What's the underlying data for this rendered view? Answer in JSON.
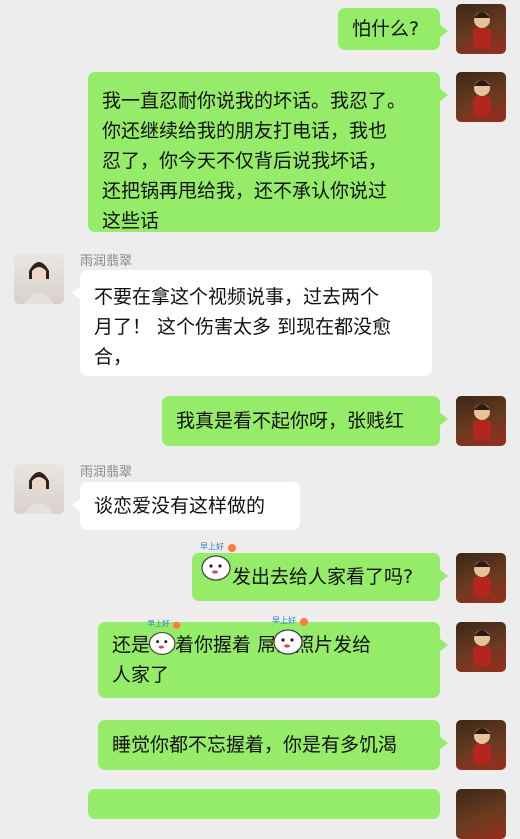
{
  "messages": [
    {
      "from": "me",
      "lines": [
        "怕什么?"
      ]
    },
    {
      "from": "me",
      "lines": [
        "我一直忍耐你说我的坏话。我忍了。",
        "你还继续给我的朋友打电话，我也",
        "忍了，你今天不仅背后说我坏话，",
        "还把锅再甩给我，还不承认你说过",
        "这些话"
      ]
    },
    {
      "from": "her",
      "sender": "雨润翡翠",
      "lines": [
        "不要在拿这个视频说事，过去两个",
        "月了！ 这个伤害太多 到现在都没愈",
        "合，"
      ]
    },
    {
      "from": "me",
      "lines": [
        "我真是看不起你呀，张贱红"
      ]
    },
    {
      "from": "her",
      "sender": "雨润翡翠",
      "lines": [
        "谈恋爱没有这样做的"
      ]
    },
    {
      "from": "me",
      "lines": [
        "发出去给人家看了吗?"
      ]
    },
    {
      "from": "me",
      "lines": [
        "还是 拿着你握着 屌的照片发给",
        "人家了"
      ]
    },
    {
      "from": "me",
      "lines": [
        "睡觉你都不忘握着，你是有多饥渴"
      ]
    }
  ],
  "stickers": [
    {
      "icon": "morning-sticker-icon",
      "caption": "早上好"
    },
    {
      "icon": "morning-sticker-icon",
      "caption": "早上好"
    },
    {
      "icon": "morning-sticker-icon",
      "caption": "早上好"
    }
  ],
  "colors": {
    "my_bubble": "#95ec69",
    "their_bubble": "#ffffff",
    "background": "#ededed"
  }
}
